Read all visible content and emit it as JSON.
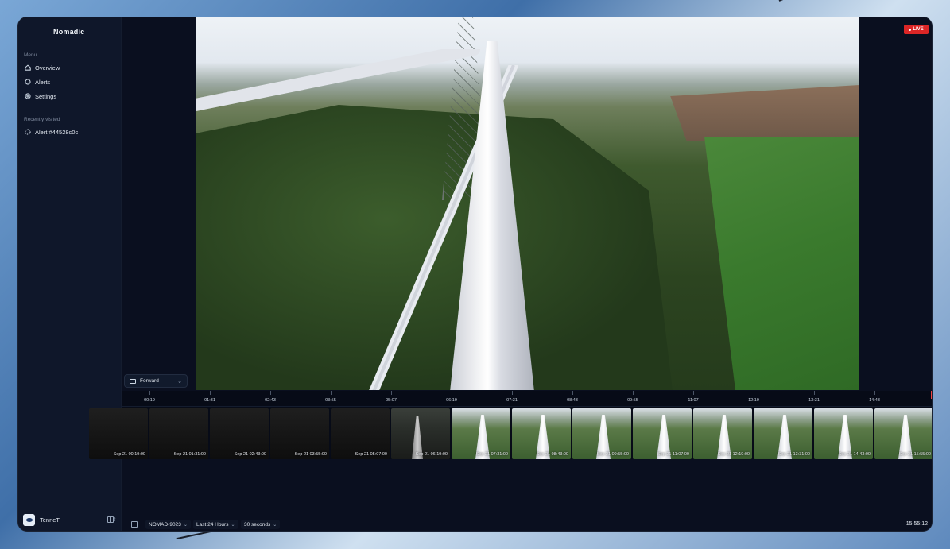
{
  "app": {
    "brand": "Nomadic"
  },
  "sidebar": {
    "menu_label": "Menu",
    "items": [
      {
        "label": "Overview",
        "icon": "home-icon"
      },
      {
        "label": "Alerts",
        "icon": "chat-bubble-icon"
      },
      {
        "label": "Settings",
        "icon": "gear-icon"
      }
    ],
    "recent_label": "Recently visited",
    "recent": [
      {
        "label": "Alert #44528c0c",
        "icon": "dashed-circle-icon"
      }
    ],
    "account": {
      "name": "TenneT"
    }
  },
  "video": {
    "view_select": "Forward",
    "live_label": "LIVE"
  },
  "timeline": {
    "ticks": [
      "00:19",
      "01:31",
      "02:43",
      "03:55",
      "05:07",
      "06:19",
      "07:31",
      "08:43",
      "09:55",
      "11:07",
      "12:19",
      "13:31",
      "14:43"
    ],
    "thumbnails": [
      {
        "label": "Sep 21 00:19:00",
        "kind": "dark"
      },
      {
        "label": "Sep 21 01:31:00",
        "kind": "dark"
      },
      {
        "label": "Sep 21 02:43:00",
        "kind": "dark"
      },
      {
        "label": "Sep 21 03:55:00",
        "kind": "dark"
      },
      {
        "label": "Sep 21 05:07:00",
        "kind": "dark"
      },
      {
        "label": "Sep 21 06:19:00",
        "kind": "dusk"
      },
      {
        "label": "Sep 21 07:31:00",
        "kind": "day"
      },
      {
        "label": "Sep 21 08:43:00",
        "kind": "day"
      },
      {
        "label": "Sep 21 09:55:00",
        "kind": "day"
      },
      {
        "label": "Sep 21 11:07:00",
        "kind": "day"
      },
      {
        "label": "Sep 21 12:19:00",
        "kind": "day"
      },
      {
        "label": "Sep 21 13:31:00",
        "kind": "day"
      },
      {
        "label": "Sep 21 14:43:00",
        "kind": "day"
      },
      {
        "label": "Sep 21 15:55:00",
        "kind": "day"
      }
    ]
  },
  "bottom": {
    "device": "NOMAD-9023",
    "range": "Last 24 Hours",
    "interval": "30 seconds",
    "clock": "15:55:12"
  },
  "colors": {
    "live": "#dc2626",
    "window_bg": "#0b1120",
    "sidebar_bg": "#0f172a"
  }
}
